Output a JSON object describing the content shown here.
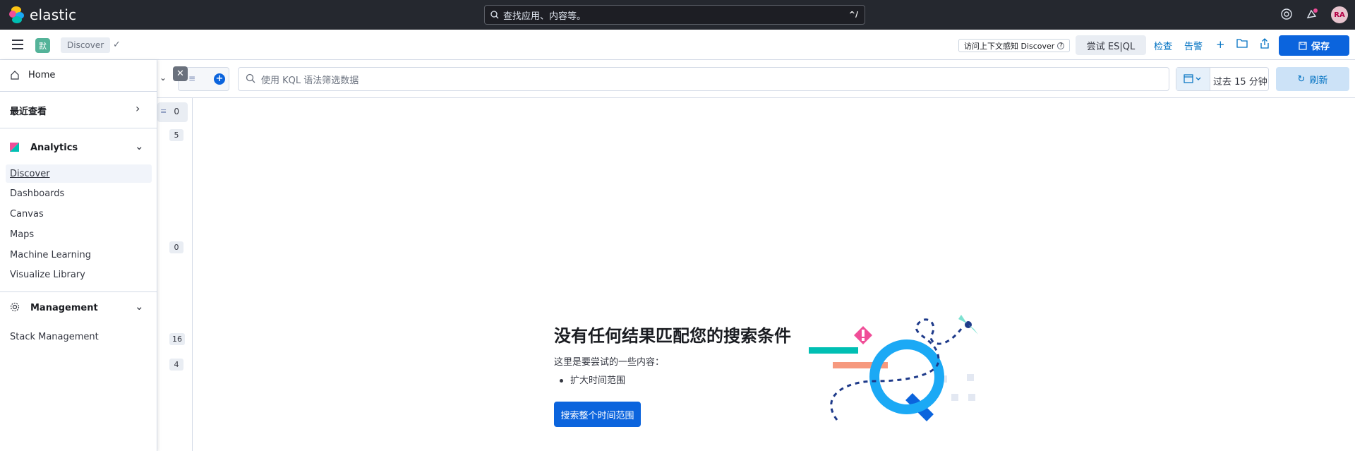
{
  "app": {
    "brand": "elastic"
  },
  "global_search": {
    "placeholder": "查找应用、内容等。",
    "shortcut": "^/"
  },
  "user": {
    "initials": "RA"
  },
  "header": {
    "space_initial": "默",
    "breadcrumb": "Discover",
    "context_help": "访问上下文感知 Discover",
    "esql_label": "尝试 ES|QL",
    "inspect_label": "检查",
    "alerts_label": "告警",
    "save_label": "保存"
  },
  "query": {
    "kql_placeholder": "使用 KQL 语法筛选数据",
    "date_label": "过去 15 分钟",
    "refresh_label": "刷新"
  },
  "side_counts": [
    "0",
    "5",
    "0",
    "16",
    "4"
  ],
  "nav_drawer": {
    "home": "Home",
    "recent": "最近查看",
    "analytics": {
      "title": "Analytics",
      "items": [
        "Discover",
        "Dashboards",
        "Canvas",
        "Maps",
        "Machine Learning",
        "Visualize Library"
      ]
    },
    "management": {
      "title": "Management",
      "items": [
        "Stack Management"
      ]
    }
  },
  "empty_state": {
    "title": "没有任何结果匹配您的搜索条件",
    "subtitle": "这里是要尝试的一些内容：",
    "suggestion": "扩大时间范围",
    "button": "搜索整个时间范围"
  },
  "colors": {
    "accent": "#0b64dd",
    "topbar": "#25282f",
    "space": "#54b399"
  }
}
